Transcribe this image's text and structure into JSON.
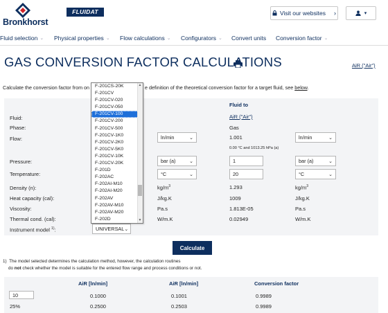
{
  "header": {
    "logo_text": "Bronkhorst",
    "fluidat_label": "FLUIDAT",
    "visit_label": "Visit our websites",
    "colors": {
      "brand": "#0d2e5e",
      "accent_red": "#d0232a"
    }
  },
  "nav": {
    "items": [
      {
        "label": "Fluid selection",
        "has_chevron": true
      },
      {
        "label": "Physical properties",
        "has_chevron": true
      },
      {
        "label": "Flow calculations",
        "has_chevron": true
      },
      {
        "label": "Configurators",
        "has_chevron": true
      },
      {
        "label": "Convert units",
        "has_chevron": false
      },
      {
        "label": "Conversion factor",
        "has_chevron": true
      }
    ]
  },
  "page": {
    "title": "GAS CONVERSION FACTOR CALCULATIONS",
    "air_link": "AiR (\"Air\")",
    "intro_before": "Calculate the conversion factor from on",
    "intro_after": "e definition of the theoretical conversion factor for a target fluid, see",
    "intro_link": "below",
    "intro_end": "."
  },
  "panel": {
    "fluid_to_header": "Fluid to",
    "labels": {
      "fluid": "Fluid:",
      "phase": "Phase:",
      "flow": "Flow:",
      "pressure": "Pressure:",
      "temperature": "Temperature:",
      "density": "Density (n):",
      "heat_capacity": "Heat capacity (cal):",
      "viscosity": "Viscosity:",
      "thermal_cond": "Thermal cond. (cal):",
      "instrument_model": "Instrument model"
    },
    "from_units": {
      "flow": "ln/min",
      "pressure": "bar (a)",
      "temperature": "°C",
      "density": "kg/m",
      "heat_capacity": "J/kg.K",
      "viscosity": "Pa.s",
      "thermal_cond": "W/m.K"
    },
    "to": {
      "fluid": "AiR (\"Air\")",
      "phase": "Gas",
      "flow": "1.001",
      "flow_unit": "ln/min",
      "flow_note": "0.00 °C and 1013.25 hPa (a)",
      "pressure": "1",
      "pressure_unit": "bar (a)",
      "temperature": "20",
      "temperature_unit": "°C",
      "density": "1.293",
      "density_unit": "kg/m",
      "heat_capacity": "1009",
      "heat_capacity_unit": "J/kg.K",
      "viscosity": "1.813E-05",
      "viscosity_unit": "Pa.s",
      "thermal_cond": "0.02949",
      "thermal_cond_unit": "W/m.K"
    },
    "instrument_model_value": "UNIVERSAL",
    "superscript_3": "3",
    "footnote_marker": "1)"
  },
  "calculate_label": "Calculate",
  "footnotes": {
    "line1_marker": "1)",
    "line1": "The model selected determines the calculation method, however, the calculation routines",
    "line2_before": "do",
    "line2_bold": "not",
    "line2_after": "check whether the model is suitable for the entered flow range and process conditions or not."
  },
  "results": {
    "headers": [
      "AiR [ln/min]",
      "AiR [ln/min]",
      "Conversion factor"
    ],
    "rows": [
      {
        "first": "10",
        "c1": "0.1000",
        "c2": "0.1001",
        "c3": "0.9989"
      },
      {
        "first": "25%",
        "c1": "0.2500",
        "c2": "0.2503",
        "c3": "0.9989"
      }
    ]
  },
  "dropdown": {
    "selected_index": 4,
    "options": [
      "F-201CS-20K",
      "F-201CV",
      "F-201CV-020",
      "F-201CV-050",
      "F-201CV-100",
      "F-201CV-200",
      "F-201CV-500",
      "F-201CV-1K0",
      "F-201CV-2K0",
      "F-201CV-5K0",
      "F-201CV-10K",
      "F-201CV-20K",
      "F-201D",
      "F-202AC",
      "F-202AI-M10",
      "F-202AI-M20",
      "F-202AV",
      "F-202AV-M10",
      "F-202AV-M20",
      "F-202D"
    ]
  }
}
